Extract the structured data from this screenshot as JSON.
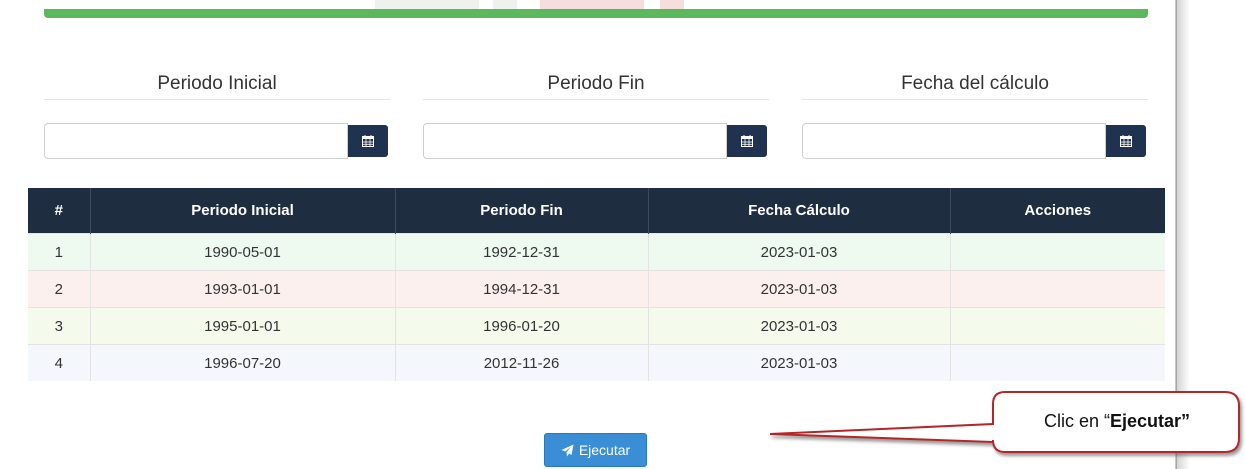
{
  "filters": {
    "periodo_inicial": {
      "label": "Periodo Inicial",
      "value": ""
    },
    "periodo_fin": {
      "label": "Periodo Fin",
      "value": ""
    },
    "fecha_calculo": {
      "label": "Fecha del cálculo",
      "value": ""
    }
  },
  "colors": {
    "top_bar": "#5cb85c",
    "header_bg": "#1f2d40",
    "calendar_button": "#1f3250",
    "execute_button": "#3a8ed6"
  },
  "table": {
    "headers": [
      "#",
      "Periodo Inicial",
      "Periodo Fin",
      "Fecha Cálculo",
      "Acciones"
    ],
    "rows": [
      [
        "1",
        "1990-05-01",
        "1992-12-31",
        "2023-01-03",
        ""
      ],
      [
        "2",
        "1993-01-01",
        "1994-12-31",
        "2023-01-03",
        ""
      ],
      [
        "3",
        "1995-01-01",
        "1996-01-20",
        "2023-01-03",
        ""
      ],
      [
        "4",
        "1996-07-20",
        "2012-11-26",
        "2023-01-03",
        ""
      ]
    ]
  },
  "execute_button": {
    "label": "Ejecutar",
    "icon": "paper-plane-icon"
  },
  "callout": {
    "prefix": "Clic en “",
    "bold": "Ejecutar”"
  }
}
